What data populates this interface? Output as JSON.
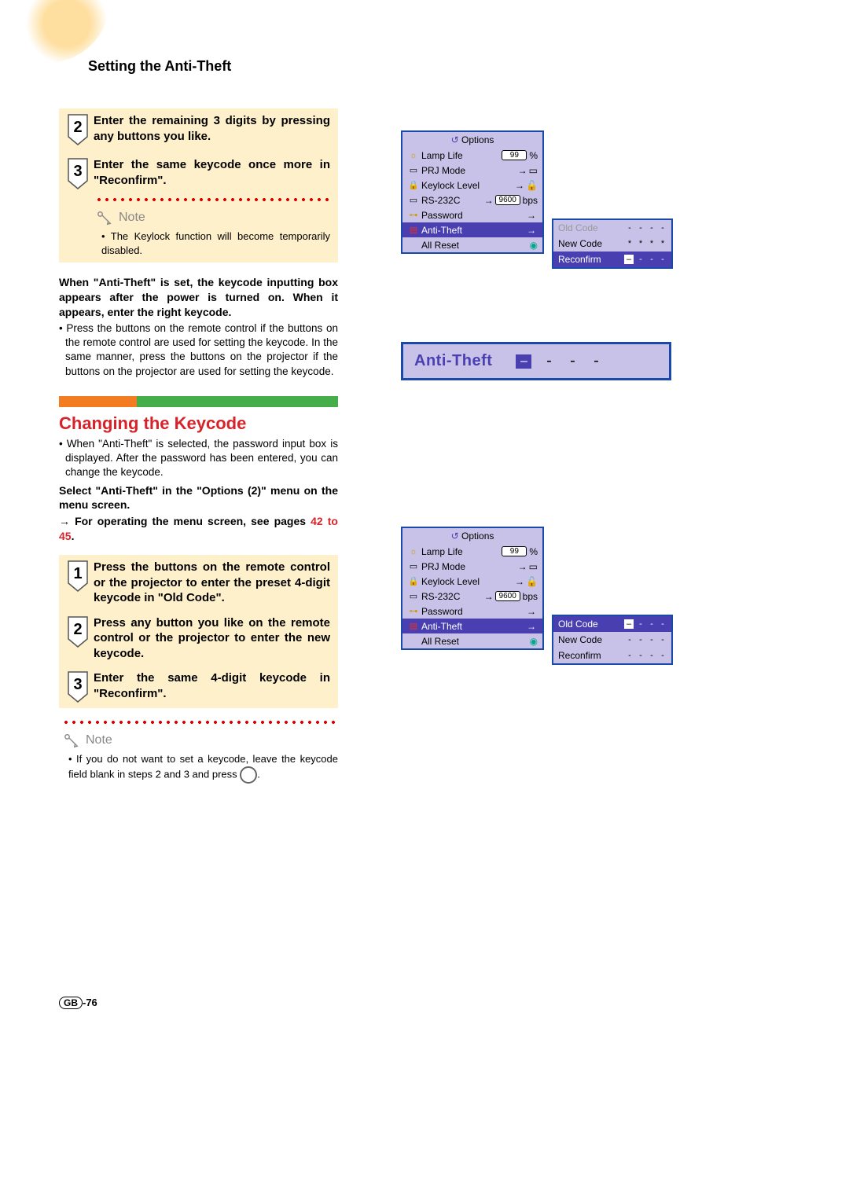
{
  "section_title": "Setting the Anti-Theft",
  "steps_a": {
    "s2": {
      "num": "2",
      "text": "Enter the remaining 3 digits by pressing any buttons you like."
    },
    "s3": {
      "num": "3",
      "text": "Enter the same keycode once more in \"Reconfirm\"."
    }
  },
  "note1": {
    "label": "Note",
    "body": "The Keylock function will become temporarily disabled."
  },
  "when_set": "When \"Anti-Theft\" is set, the keycode inputting box appears after the power is turned on. When it appears, enter the right keycode.",
  "when_set_bullet": "Press the buttons on the remote control if the buttons on the remote control are used for setting the keycode. In the same manner, press the buttons on the projector if the buttons on the projector are used for setting the keycode.",
  "changing_heading": "Changing the Keycode",
  "changing_intro": "When \"Anti-Theft\" is selected, the password input box is displayed. After the password has been entered, you can change the keycode.",
  "select_line": "Select \"Anti-Theft\" in the \"Options (2)\" menu on the menu screen.",
  "operating_line": "For operating the menu screen, see pages",
  "operating_pages": "42 to 45",
  "steps_b": {
    "s1": {
      "num": "1",
      "text": "Press the buttons on the remote control or the projector to enter the preset 4-digit keycode in \"Old Code\"."
    },
    "s2": {
      "num": "2",
      "text": "Press any button you like on the remote control or the projector to enter the new keycode."
    },
    "s3": {
      "num": "3",
      "text": "Enter the same 4-digit keycode in \"Reconfirm\"."
    }
  },
  "note2": {
    "label": "Note",
    "body_a": "If you do not want to set a keycode, leave the keycode field blank in steps 2 and 3 and press ",
    "body_b": "."
  },
  "page_footer": {
    "gb": "GB",
    "num": "-76"
  },
  "osd": {
    "title_icon": "↺",
    "title": "Options",
    "lamp_life": {
      "label": "Lamp Life",
      "value": "99",
      "unit": "%"
    },
    "prj_mode": "PRJ Mode",
    "keylock": "Keylock Level",
    "rs232c": {
      "label": "RS-232C",
      "value": "9600",
      "unit": "bps"
    },
    "password": "Password",
    "anti_theft": "Anti-Theft",
    "all_reset": "All Reset"
  },
  "codes1": {
    "old": {
      "label": "Old Code",
      "v": [
        "-",
        "-",
        "-",
        "-"
      ]
    },
    "new": {
      "label": "New Code",
      "v": [
        "*",
        "*",
        "*",
        "*"
      ]
    },
    "reconfirm": {
      "label": "Reconfirm",
      "cursor": "–",
      "v": [
        "-",
        "-",
        "-"
      ]
    }
  },
  "anti_theft_big": {
    "label": "Anti-Theft",
    "cursor": "–",
    "dashes": [
      "-",
      "-",
      "-"
    ]
  },
  "codes2": {
    "old": {
      "label": "Old Code",
      "cursor": "–",
      "v": [
        "-",
        "-",
        "-"
      ]
    },
    "new": {
      "label": "New Code",
      "v": [
        "-",
        "-",
        "-",
        "-"
      ]
    },
    "reconfirm": {
      "label": "Reconfirm",
      "v": [
        "-",
        "-",
        "-",
        "-"
      ]
    }
  }
}
